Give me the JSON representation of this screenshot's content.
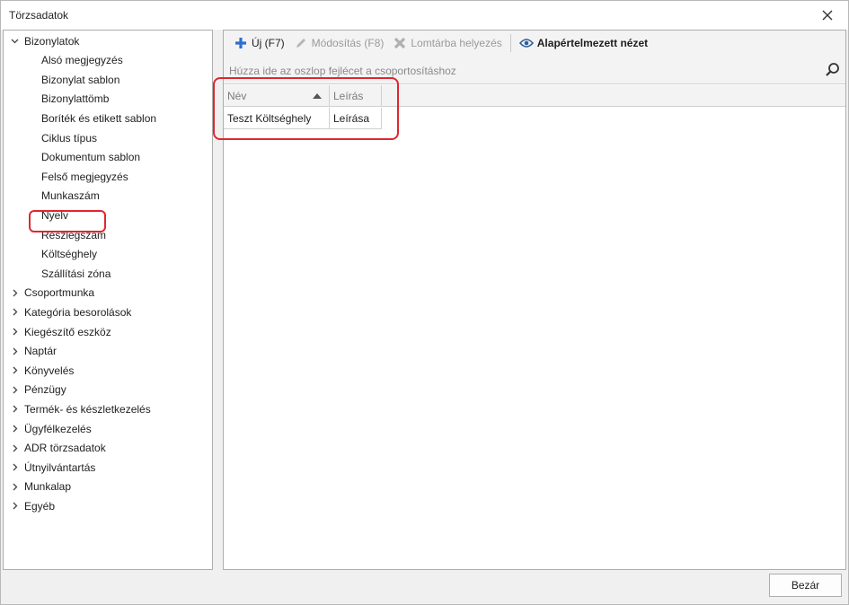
{
  "window": {
    "title": "Törzsadatok"
  },
  "sidebar": {
    "items": [
      {
        "label": "Bizonylatok",
        "expanded": true,
        "level": 0
      },
      {
        "label": "Alsó megjegyzés",
        "level": 1
      },
      {
        "label": "Bizonylat sablon",
        "level": 1
      },
      {
        "label": "Bizonylattömb",
        "level": 1
      },
      {
        "label": "Boríték és etikett sablon",
        "level": 1
      },
      {
        "label": "Ciklus típus",
        "level": 1
      },
      {
        "label": "Dokumentum sablon",
        "level": 1
      },
      {
        "label": "Felső megjegyzés",
        "level": 1
      },
      {
        "label": "Munkaszám",
        "level": 1
      },
      {
        "label": "Nyelv",
        "level": 1
      },
      {
        "label": "Részlegszám",
        "level": 1
      },
      {
        "label": "Költséghely",
        "level": 1,
        "selected": true
      },
      {
        "label": "Szállítási zóna",
        "level": 1
      },
      {
        "label": "Csoportmunka",
        "expanded": false,
        "level": 0
      },
      {
        "label": "Kategória besorolások",
        "expanded": false,
        "level": 0
      },
      {
        "label": "Kiegészítő eszköz",
        "expanded": false,
        "level": 0
      },
      {
        "label": "Naptár",
        "expanded": false,
        "level": 0
      },
      {
        "label": "Könyvelés",
        "expanded": false,
        "level": 0
      },
      {
        "label": "Pénzügy",
        "expanded": false,
        "level": 0
      },
      {
        "label": "Termék- és készletkezelés",
        "expanded": false,
        "level": 0
      },
      {
        "label": "Ügyfélkezelés",
        "expanded": false,
        "level": 0
      },
      {
        "label": "ADR törzsadatok",
        "expanded": false,
        "level": 0
      },
      {
        "label": "Útnyilvántartás",
        "expanded": false,
        "level": 0
      },
      {
        "label": "Munkalap",
        "expanded": false,
        "level": 0
      },
      {
        "label": "Egyéb",
        "expanded": false,
        "level": 0
      }
    ]
  },
  "toolbar": {
    "new_label": "Új (F7)",
    "edit_label": "Módosítás (F8)",
    "trash_label": "Lomtárba helyezés",
    "default_view_label": "Alapértelmezett nézet"
  },
  "grid": {
    "group_hint": "Húzza ide az oszlop fejlécet a csoportosításhoz",
    "columns": [
      "Név",
      "Leírás"
    ],
    "rows": [
      [
        "Teszt Költséghely",
        "Leírása"
      ]
    ]
  },
  "footer": {
    "close_label": "Bezár"
  },
  "colors": {
    "highlight": "#e0262e",
    "add_icon": "#2f6fd1",
    "eye_icon": "#2e5f9a"
  }
}
